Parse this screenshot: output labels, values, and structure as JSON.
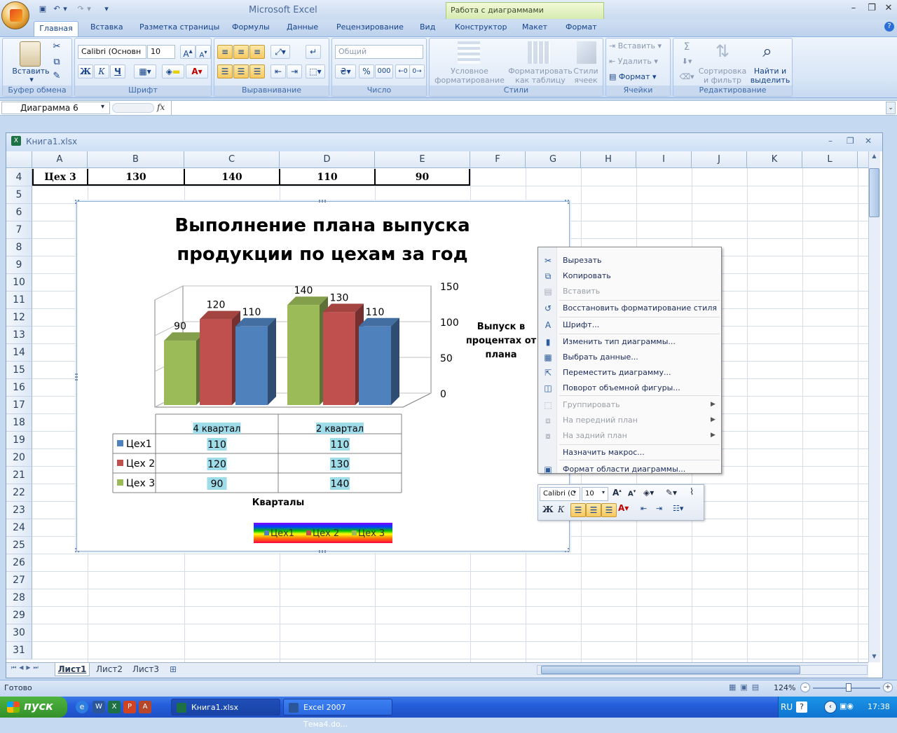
{
  "app_title": "Microsoft Excel",
  "contextual_tab_group": "Работа с диаграммами",
  "ribbon_tabs": [
    "Главная",
    "Вставка",
    "Разметка страницы",
    "Формулы",
    "Данные",
    "Рецензирование",
    "Вид",
    "Конструктор",
    "Макет",
    "Формат"
  ],
  "ribbon": {
    "clipboard": {
      "paste": "Вставить",
      "label": "Буфер обмена"
    },
    "font": {
      "name": "Calibri (Основн",
      "size": "10",
      "label": "Шрифт",
      "bold": "Ж",
      "italic": "К",
      "underline": "Ч"
    },
    "alignment": {
      "label": "Выравнивание"
    },
    "number": {
      "format": "Общий",
      "label": "Число",
      "percent": "%",
      "thousands": "000"
    },
    "styles": {
      "conditional": [
        "Условное",
        "форматирование"
      ],
      "as_table": [
        "Форматировать",
        "как таблицу"
      ],
      "cell_styles": [
        "Стили",
        "ячеек"
      ],
      "label": "Стили"
    },
    "cells": {
      "insert": "Вставить",
      "delete": "Удалить",
      "format": "Формат",
      "label": "Ячейки"
    },
    "editing": {
      "sort": [
        "Сортировка",
        "и фильтр"
      ],
      "find": [
        "Найти и",
        "выделить"
      ],
      "label": "Редактирование",
      "sigma": "Σ"
    }
  },
  "formula_bar": {
    "name_box": "Диаграмма 6",
    "fx": "fx",
    "formula": ""
  },
  "workbook": {
    "title": "Книга1.xlsx"
  },
  "columns": [
    "A",
    "B",
    "C",
    "D",
    "E",
    "F",
    "G",
    "H",
    "I",
    "J",
    "K",
    "L"
  ],
  "rows": [
    "4",
    "5",
    "6",
    "7",
    "8",
    "9",
    "10",
    "11",
    "12",
    "13",
    "14",
    "15",
    "16",
    "17",
    "18",
    "19",
    "20",
    "21",
    "22",
    "23",
    "24",
    "25",
    "26",
    "27",
    "28",
    "29",
    "30",
    "31"
  ],
  "row4": [
    "Цех 3",
    "130",
    "140",
    "110",
    "90"
  ],
  "chart": {
    "title_line1": "Выполнение плана выпуска",
    "title_line2": "продукции по цехам за год",
    "y_axis_label_lines": [
      "Выпуск в",
      "процентах от",
      "плана"
    ],
    "x_axis_label": "Кварталы",
    "legend": [
      "Цех1",
      "Цех 2",
      "Цех 3"
    ]
  },
  "chart_data": {
    "type": "bar",
    "categories": [
      "4 квартал",
      "2 квартал"
    ],
    "series": [
      {
        "name": "Цех1",
        "values": [
          110,
          110
        ],
        "color": "#4f81bd"
      },
      {
        "name": "Цех 2",
        "values": [
          120,
          130
        ],
        "color": "#c0504d"
      },
      {
        "name": "Цех 3",
        "values": [
          90,
          140
        ],
        "color": "#9bbb59"
      }
    ],
    "title": "Выполнение плана выпуска продукции по цехам за год",
    "xlabel": "Кварталы",
    "ylabel": "Выпуск в процентах от плана",
    "ylim": [
      0,
      150
    ],
    "yticks": [
      "150",
      "100",
      "50",
      "0"
    ],
    "data_table": true,
    "legend_position": "bottom",
    "three_d": true
  },
  "context_menu": [
    {
      "label": "Вырезать",
      "icon": "scissors-icon",
      "enabled": true
    },
    {
      "label": "Копировать",
      "icon": "copy-icon",
      "enabled": true
    },
    {
      "label": "Вставить",
      "icon": "paste-icon",
      "enabled": false
    },
    {
      "label": "Восстановить форматирование стиля",
      "icon": "reset-style-icon",
      "enabled": true
    },
    {
      "label": "Шрифт...",
      "icon": "font-icon",
      "enabled": true
    },
    {
      "label": "Изменить тип диаграммы...",
      "icon": "chart-type-icon",
      "enabled": true
    },
    {
      "label": "Выбрать данные...",
      "icon": "select-data-icon",
      "enabled": true
    },
    {
      "label": "Переместить диаграмму...",
      "icon": "move-chart-icon",
      "enabled": true
    },
    {
      "label": "Поворот объемной фигуры...",
      "icon": "rotate-3d-icon",
      "enabled": true
    },
    {
      "label": "Группировать",
      "icon": "group-icon",
      "enabled": false
    },
    {
      "label": "На передний план",
      "icon": "bring-front-icon",
      "enabled": false
    },
    {
      "label": "На задний план",
      "icon": "send-back-icon",
      "enabled": false
    },
    {
      "label": "Назначить макрос...",
      "icon": "",
      "enabled": true
    },
    {
      "label": "Формат области диаграммы...",
      "icon": "format-area-icon",
      "enabled": true
    }
  ],
  "mini_toolbar": {
    "font": "Calibri (С",
    "size": "10",
    "bold": "Ж",
    "italic": "К"
  },
  "sheets": [
    "Лист1",
    "Лист2",
    "Лист3"
  ],
  "status": {
    "ready": "Готово",
    "zoom": "124%"
  },
  "taskbar": {
    "start": "пуск",
    "tasks": [
      "Книга1.xlsx",
      "Excel 2007 Тема4.do..."
    ],
    "lang": "RU",
    "time": "17:38"
  },
  "colors": {
    "series1": "#4f81bd",
    "series2": "#c0504d",
    "series3": "#9bbb59",
    "ribbon_bg": "#dbe7f7",
    "taskbar": "#245edb"
  }
}
